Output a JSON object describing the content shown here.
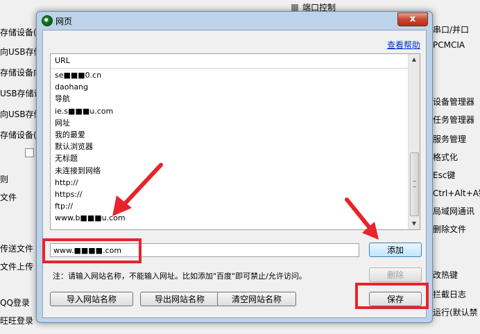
{
  "background": {
    "left_rows": [
      "存储设备(",
      "向USB存储",
      "存储设备向",
      "USB存储设",
      "向USB存储",
      "存储设备(可",
      "",
      "则",
      "文件",
      "",
      "",
      "传送文件",
      "文件上传",
      "",
      "QQ登录",
      "旺旺登录"
    ],
    "top_right": "端口控制",
    "right_rows": [
      "串口/并口",
      "PCMCIA",
      "设备管理器",
      "任务管理器",
      "服务管理",
      "格式化",
      "Esc键",
      "Ctrl+Alt+A键",
      "局域网通讯",
      "删除文件",
      "改热键",
      "拦截日志",
      "运行(默认禁"
    ]
  },
  "dialog": {
    "title": "网页",
    "close_label": "x",
    "help_link": "查看帮助",
    "list_header": "URL",
    "list_items": [
      "se■■■0.cn",
      "daohang",
      "导航",
      "ie.s■■■u.com",
      "网址",
      "我的最爱",
      "默认浏览器",
      "无标题",
      "未连接到网络",
      "http://",
      "https://",
      "ftp://",
      "www.b■■■u.com"
    ],
    "input_value": "www.■■■■.com",
    "buttons": {
      "add": "添加",
      "delete": "删除",
      "save": "保存",
      "import": "导入网站名称",
      "export": "导出网站名称",
      "clear": "清空网站名称"
    },
    "note": "注：请输入网站名称，不能输入网址。比如添加\"百度\"即可禁止/允许访问。"
  },
  "colors": {
    "annotation": "#e8232a",
    "link": "#0033cc",
    "dialog_frame": "#bcd3e9"
  }
}
